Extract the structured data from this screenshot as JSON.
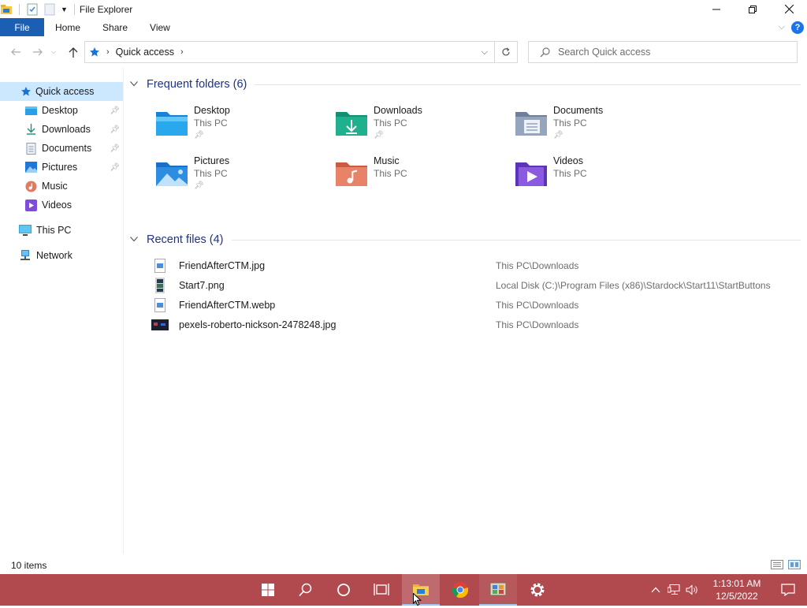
{
  "window": {
    "title": "File Explorer"
  },
  "ribbon": {
    "tabs": [
      "File",
      "Home",
      "Share",
      "View"
    ]
  },
  "address": {
    "location": "Quick access",
    "search_placeholder": "Search Quick access"
  },
  "sidebar": {
    "quick_access": "Quick access",
    "pinned": [
      {
        "label": "Desktop",
        "icon": "desktop-icon"
      },
      {
        "label": "Downloads",
        "icon": "download-icon"
      },
      {
        "label": "Documents",
        "icon": "document-icon"
      },
      {
        "label": "Pictures",
        "icon": "picture-icon"
      }
    ],
    "unpinned": [
      {
        "label": "Music",
        "icon": "music-icon"
      },
      {
        "label": "Videos",
        "icon": "video-icon"
      }
    ],
    "this_pc": "This PC",
    "network": "Network"
  },
  "frequent": {
    "header": "Frequent folders (6)",
    "items": [
      {
        "name": "Desktop",
        "sub": "This PC",
        "pinned": true,
        "color": "#2a9fe6"
      },
      {
        "name": "Downloads",
        "sub": "This PC",
        "pinned": true,
        "color": "#1fae8c"
      },
      {
        "name": "Documents",
        "sub": "This PC",
        "pinned": true,
        "color": "#8a9bb5"
      },
      {
        "name": "Pictures",
        "sub": "This PC",
        "pinned": true,
        "color": "#2d8de0"
      },
      {
        "name": "Music",
        "sub": "This PC",
        "pinned": false,
        "color": "#e0754f"
      },
      {
        "name": "Videos",
        "sub": "This PC",
        "pinned": false,
        "color": "#7d4dd8"
      }
    ]
  },
  "recent": {
    "header": "Recent files (4)",
    "files": [
      {
        "name": "FriendAfterCTM.jpg",
        "location": "This PC\\Downloads"
      },
      {
        "name": "Start7.png",
        "location": "Local Disk (C:)\\Program Files (x86)\\Stardock\\Start11\\StartButtons"
      },
      {
        "name": "FriendAfterCTM.webp",
        "location": "This PC\\Downloads"
      },
      {
        "name": "pexels-roberto-nickson-2478248.jpg",
        "location": "This PC\\Downloads"
      }
    ]
  },
  "status": {
    "items": "10 items"
  },
  "taskbar": {
    "time": "1:13:01 AM",
    "date": "12/5/2022",
    "color": "#b04a4f"
  }
}
